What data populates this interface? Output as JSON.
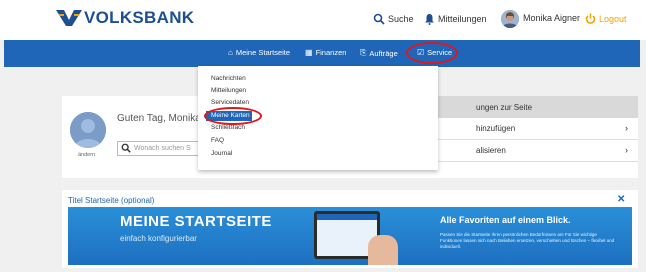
{
  "header": {
    "brand": "VOLKSBANK",
    "search_label": "Suche",
    "notifications_label": "Mitteilungen",
    "user_name": "Monika Aigner",
    "logout_label": "Logout"
  },
  "nav": {
    "items": [
      {
        "label": "Meine Startseite",
        "icon": "home-icon"
      },
      {
        "label": "Finanzen",
        "icon": "finance-icon"
      },
      {
        "label": "Aufträge",
        "icon": "orders-icon"
      },
      {
        "label": "Service",
        "icon": "service-icon"
      }
    ]
  },
  "dropdown": {
    "items": [
      "Nachrichten",
      "Mitteilungen",
      "Servicedaten",
      "Meine Karten",
      "Schließfach",
      "FAQ",
      "Journal"
    ],
    "highlighted": "Meine Karten"
  },
  "profile": {
    "greeting": "Guten Tag, Monika",
    "change_label": "ändern",
    "search_placeholder": "Wonach suchen S"
  },
  "right_panel": {
    "title": "ungen zur Seite",
    "rows": [
      "hinzufügen",
      "alisieren"
    ]
  },
  "banner": {
    "title": "Titel Startseite (optional)",
    "headline": "MEINE STARTSEITE",
    "subline": "einfach konfigurierbar",
    "favorites": "Alle Favoriten auf einem Blick.",
    "small_text": "Passen Sie die Startseite Ihren persönlichen Bedürfnissen an! Für Sie wichtige Funktionen lassen sich nach Belieben ersetzen, verschieben und löschen – flexibel und individuell."
  },
  "colors": {
    "brand_blue": "#1f66b8",
    "logout_orange": "#f5a200",
    "highlight_red": "#e0171b"
  }
}
